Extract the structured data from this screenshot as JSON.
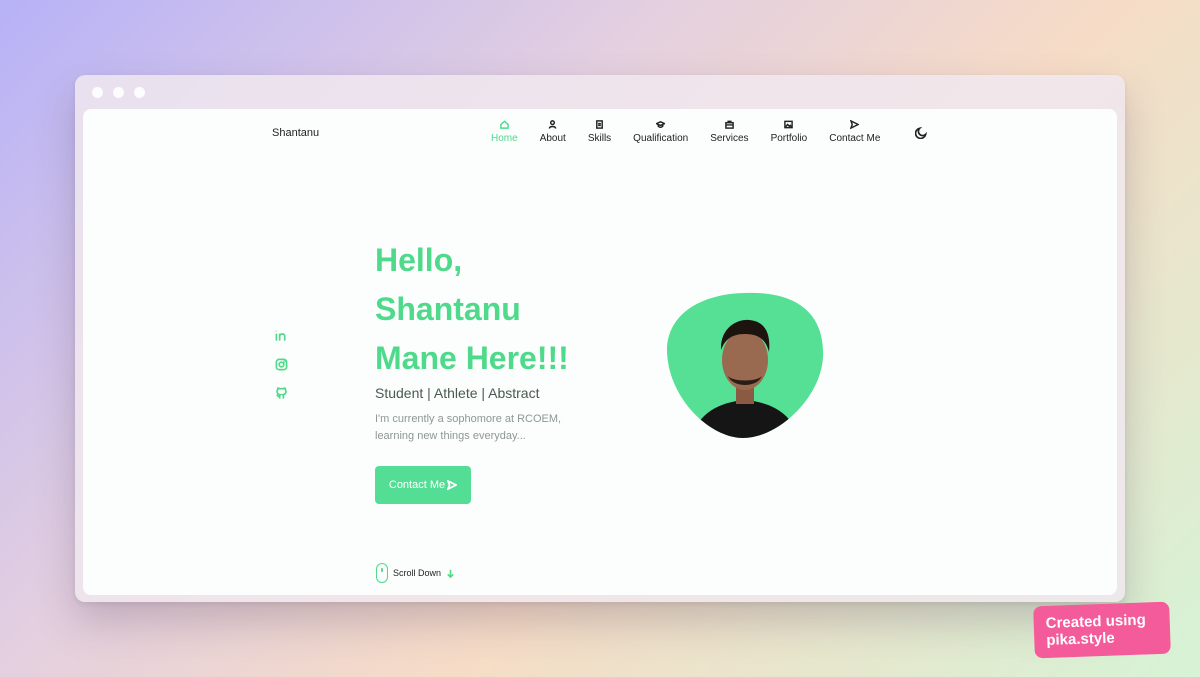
{
  "site": {
    "logo": "Shantanu"
  },
  "nav": {
    "items": [
      {
        "label": "Home",
        "icon": "home-icon",
        "active": true
      },
      {
        "label": "About",
        "icon": "user-icon"
      },
      {
        "label": "Skills",
        "icon": "file-icon"
      },
      {
        "label": "Qualification",
        "icon": "graduation-cap-icon"
      },
      {
        "label": "Services",
        "icon": "briefcase-icon"
      },
      {
        "label": "Portfolio",
        "icon": "image-icon"
      },
      {
        "label": "Contact Me",
        "icon": "send-icon"
      }
    ],
    "theme_icon": "moon-icon"
  },
  "socials": [
    "linkedin-icon",
    "instagram-icon",
    "github-icon"
  ],
  "hero": {
    "title_line1": "Hello,",
    "title_line2": "Shantanu",
    "title_line3": "Mane Here!!!",
    "subtitle": "Student | Athlete | Abstract",
    "description": "I'm currently a sophomore at RCOEM, learning new things everyday...",
    "cta_label": "Contact Me"
  },
  "scroll": {
    "label": "Scroll Down"
  },
  "watermark": {
    "line1": "Created using",
    "line2": "pika.style"
  },
  "colors": {
    "accent": "#4fd98b",
    "button": "#54de95",
    "badge": "#f35b9a"
  }
}
